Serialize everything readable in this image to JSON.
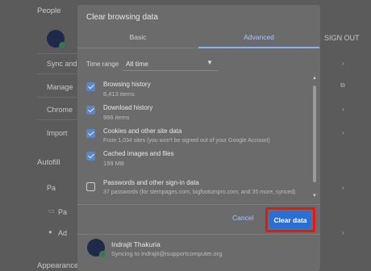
{
  "background": {
    "section_people": "People",
    "side_label_1": "Sync and",
    "side_label_2": "Manage",
    "side_label_3": "Chrome",
    "side_label_4": "Import",
    "section_autofill": "Autofill",
    "row_pass": "Pa",
    "row_pay": "Pa",
    "row_addr": "Ad",
    "sign_out": "SIGN OUT",
    "section_appearance": "Appearance"
  },
  "dialog": {
    "title": "Clear browsing data",
    "tabs": [
      {
        "label": "Basic",
        "active": false
      },
      {
        "label": "Advanced",
        "active": true
      }
    ],
    "time_range": {
      "label": "Time range",
      "value": "All time"
    },
    "items": [
      {
        "title": "Browsing history",
        "subtitle": "8,413 items",
        "checked": true
      },
      {
        "title": "Download history",
        "subtitle": "996 items",
        "checked": true
      },
      {
        "title": "Cookies and other site data",
        "subtitle": "From 1,034 sites (you won't be signed out of your Google Account)",
        "checked": true
      },
      {
        "title": "Cached images and files",
        "subtitle": "199 MB",
        "checked": true
      },
      {
        "title": "Passwords and other sign-in data",
        "subtitle": "37 passwords (for stempages.com, bigfootumpro.com, and 35 more, synced)",
        "checked": false
      }
    ],
    "cancel_label": "Cancel",
    "clear_label": "Clear data",
    "account": {
      "name": "Indrajit Thakuria",
      "sync": "Syncing to indrajit@isupportcomputer.org"
    }
  },
  "colors": {
    "accent": "#2b6fd6",
    "highlight": "#e01818",
    "tab_active": "#8ab4f8"
  }
}
